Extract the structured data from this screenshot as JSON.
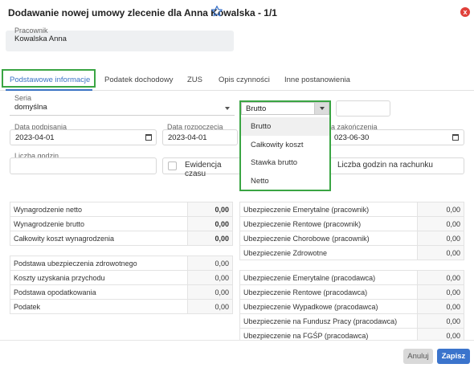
{
  "header": {
    "title": "Dodawanie nowej umowy zlecenie dla Anna Kowalska - 1/1",
    "close_glyph": "x"
  },
  "employee": {
    "label": "Pracownik",
    "value": "Kowalska Anna"
  },
  "tabs": [
    {
      "label": "Podstawowe informacje"
    },
    {
      "label": "Podatek dochodowy"
    },
    {
      "label": "ZUS"
    },
    {
      "label": "Opis czynności"
    },
    {
      "label": "Inne postanowienia"
    }
  ],
  "seria": {
    "label": "Seria",
    "value": "domyślna"
  },
  "amount_type": {
    "selected": "Brutto",
    "options": [
      "Brutto",
      "Całkowity koszt",
      "Stawka brutto",
      "Netto"
    ]
  },
  "dates": {
    "signing": {
      "label": "Data podpisania",
      "value": "2023-04-01"
    },
    "start": {
      "label": "Data rozpoczęcia",
      "value": "2023-04-01"
    },
    "end": {
      "label": "a zakończenia",
      "value": "023-06-30"
    }
  },
  "hours": {
    "label": "Liczba godzin"
  },
  "evidence": {
    "label": "Ewidencja czasu"
  },
  "hours_invoice": {
    "label": "Liczba godzin na rachunku"
  },
  "summary_left": [
    {
      "label": "Wynagrodzenie netto",
      "value": "0,00"
    },
    {
      "label": "Wynagrodzenie brutto",
      "value": "0,00"
    },
    {
      "label": "Całkowity koszt wynagrodzenia",
      "value": "0,00"
    }
  ],
  "details_left": [
    {
      "label": "Podstawa ubezpieczenia zdrowotnego",
      "value": "0,00"
    },
    {
      "label": "Koszty uzyskania przychodu",
      "value": "0,00"
    },
    {
      "label": "Podstawa opodatkowania",
      "value": "0,00"
    },
    {
      "label": "Podatek",
      "value": "0,00"
    }
  ],
  "insurance_employee": [
    {
      "label": "Ubezpieczenie Emerytalne (pracownik)",
      "value": "0,00"
    },
    {
      "label": "Ubezpieczenie Rentowe (pracownik)",
      "value": "0,00"
    },
    {
      "label": "Ubezpieczenie Chorobowe (pracownik)",
      "value": "0,00"
    },
    {
      "label": "Ubezpieczenie Zdrowotne",
      "value": "0,00"
    }
  ],
  "insurance_employer": [
    {
      "label": "Ubezpieczenie Emerytalne (pracodawca)",
      "value": "0,00"
    },
    {
      "label": "Ubezpieczenie Rentowe (pracodawca)",
      "value": "0,00"
    },
    {
      "label": "Ubezpieczenie Wypadkowe (pracodawca)",
      "value": "0,00"
    },
    {
      "label": "Ubezpieczenie na Fundusz Pracy (pracodawca)",
      "value": "0,00"
    },
    {
      "label": "Ubezpieczenie na FGŚP (pracodawca)",
      "value": "0,00"
    }
  ],
  "footer": {
    "cancel_label": "Anuluj",
    "save_label": "Zapisz"
  },
  "colors": {
    "accent": "#3b74cc",
    "highlight": "#3aa543",
    "close": "#e0403a"
  }
}
